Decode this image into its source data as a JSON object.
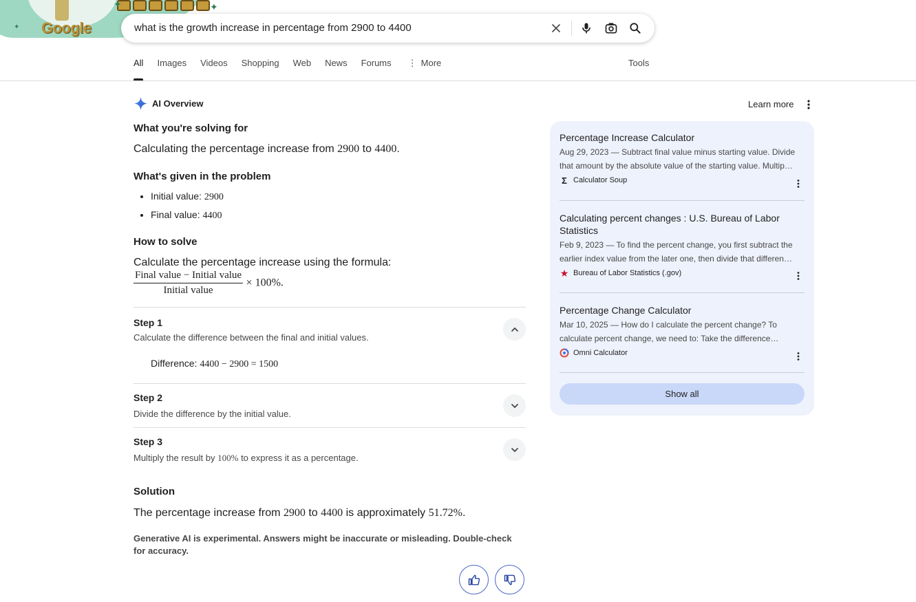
{
  "header": {
    "logo_text": "Google",
    "search_query": "what is the growth increase in percentage from 2900 to 4400",
    "tabs": [
      {
        "label": "All",
        "active": true
      },
      {
        "label": "Images"
      },
      {
        "label": "Videos"
      },
      {
        "label": "Shopping"
      },
      {
        "label": "Web"
      },
      {
        "label": "News"
      },
      {
        "label": "Forums"
      },
      {
        "label": "More"
      }
    ],
    "tools_label": "Tools"
  },
  "ai_overview": {
    "title": "AI Overview",
    "learn_more": "Learn more",
    "solving_heading": "What you're solving for",
    "solving_text_pre": "Calculating the percentage increase from ",
    "solving_a": "2900",
    "solving_mid": " to ",
    "solving_b": "4400",
    "solving_end": ".",
    "given_heading": "What's given in the problem",
    "given": [
      {
        "label": "Initial value: ",
        "value": "2900"
      },
      {
        "label": "Final value: ",
        "value": "4400"
      }
    ],
    "how_heading": "How to solve",
    "how_text": "Calculate the percentage increase using the formula:",
    "formula_num": "Final value − Initial value",
    "formula_den": "Initial value",
    "formula_tail": "× 100%.",
    "steps": [
      {
        "title": "Step 1",
        "desc": "Calculate the difference between the final and initial values.",
        "detail_label": "Difference: ",
        "detail_math": "4400 − 2900 = 1500",
        "expanded": true
      },
      {
        "title": "Step 2",
        "desc": "Divide the difference by the initial value."
      },
      {
        "title": "Step 3",
        "desc_pre": "Multiply the result by ",
        "desc_math": "100%",
        "desc_post": " to express it as a percentage."
      }
    ],
    "solution_heading": "Solution",
    "solution_pre": "The percentage increase from ",
    "solution_a": "2900",
    "solution_mid": " to ",
    "solution_b": "4400",
    "solution_mid2": " is approximately ",
    "solution_val": "51.72%",
    "solution_end": ".",
    "disclaimer": "Generative AI is experimental. Answers might be inaccurate or misleading. Double-check for accuracy."
  },
  "sources": [
    {
      "title": "Percentage Increase Calculator",
      "snippet_1": "Aug 29, 2023 — Subtract final value minus starting value. Divide",
      "snippet_2": "that amount by the absolute value of the starting value. Multip…",
      "site": "Calculator Soup"
    },
    {
      "title_1": "Calculating percent changes : U.S. Bureau of Labor",
      "title_2": "Statistics",
      "snippet_1": "Feb 9, 2023 — To find the percent change, you first subtract the",
      "snippet_2": "earlier index value from the later one, then divide that differen…",
      "site": "Bureau of Labor Statistics (.gov)"
    },
    {
      "title": "Percentage Change Calculator",
      "snippet_1": "Mar 10, 2025 — How do I calculate the percent change? To",
      "snippet_2": "calculate percent change, we need to: Take the difference…",
      "site": "Omni Calculator"
    }
  ],
  "show_all": "Show all"
}
